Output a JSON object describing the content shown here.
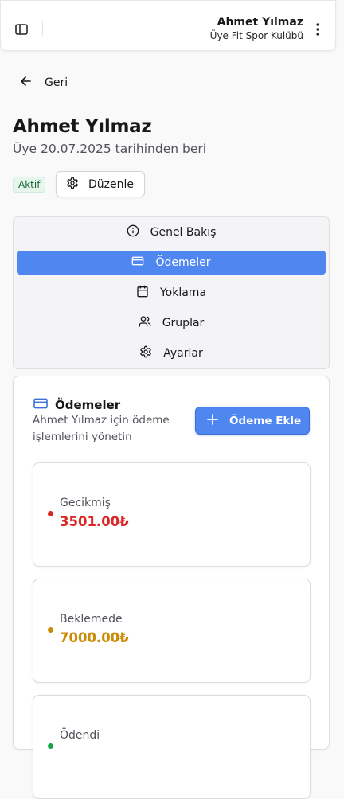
{
  "header": {
    "user_name": "Ahmet Yılmaz",
    "club_name": "Üye Fit Spor Kulübü"
  },
  "nav": {
    "back_label": "Geri"
  },
  "profile": {
    "name": "Ahmet Yılmaz",
    "member_since": "Üye 20.07.2025 tarihinden beri",
    "status": "Aktif",
    "edit_label": "Düzenle"
  },
  "tabs": [
    {
      "label": "Genel Bakış",
      "icon": "info-icon",
      "active": false
    },
    {
      "label": "Ödemeler",
      "icon": "credit-card-icon",
      "active": true
    },
    {
      "label": "Yoklama",
      "icon": "calendar-icon",
      "active": false
    },
    {
      "label": "Gruplar",
      "icon": "users-icon",
      "active": false
    },
    {
      "label": "Ayarlar",
      "icon": "gear-icon",
      "active": false
    }
  ],
  "payments": {
    "title": "Ödemeler",
    "description": "Ahmet Yılmaz için ödeme işlemlerini yönetin",
    "add_label": "Ödeme Ekle",
    "stats": [
      {
        "label": "Gecikmiş",
        "value": "3501.00₺",
        "color": "#dc2626"
      },
      {
        "label": "Beklemede",
        "value": "7000.00₺",
        "color": "#ca8a04"
      },
      {
        "label": "Ödendi",
        "value": "",
        "color": "#16a34a"
      }
    ]
  },
  "colors": {
    "accent": "#4f86f0",
    "active_badge_bg": "#e7f6ec",
    "active_badge_text": "#166534"
  }
}
